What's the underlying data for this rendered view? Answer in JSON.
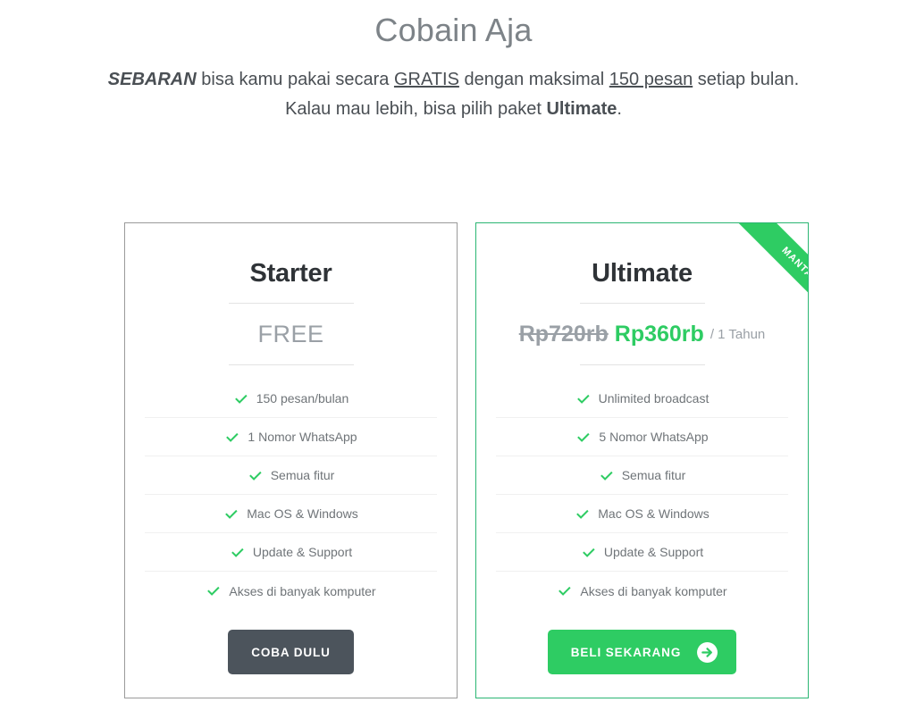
{
  "header": {
    "title": "Cobain Aja",
    "subtitle_line1": {
      "brand": "SEBARAN",
      "part1": " bisa kamu pakai secara ",
      "free_word": "GRATIS",
      "part2": " dengan maksimal ",
      "quota": "150 pesan",
      "part3": " setiap bulan."
    },
    "subtitle_line2": {
      "part1": "Kalau mau lebih, bisa pilih paket ",
      "plan": "Ultimate",
      "part2": "."
    }
  },
  "colors": {
    "brand_green": "#2ecc63",
    "border_green": "#2bb673",
    "border_gray": "#9a9a9a",
    "dark_button": "#4c545c",
    "muted_text": "#9aa0a6"
  },
  "plans": [
    {
      "id": "starter",
      "name": "Starter",
      "price_free_label": "FREE",
      "features": [
        "150 pesan/bulan",
        "1 Nomor WhatsApp",
        "Semua fitur",
        "Mac OS & Windows",
        "Update & Support",
        "Akses di banyak komputer"
      ],
      "cta_label": "COBA DULU"
    },
    {
      "id": "ultimate",
      "name": "Ultimate",
      "ribbon_label": "MANTAP!",
      "price_old": "Rp720rb",
      "price_new": "Rp360rb",
      "price_period": "/ 1 Tahun",
      "features": [
        "Unlimited broadcast",
        "5 Nomor WhatsApp",
        "Semua fitur",
        "Mac OS & Windows",
        "Update & Support",
        "Akses di banyak komputer"
      ],
      "cta_label": "BELI SEKARANG"
    }
  ]
}
